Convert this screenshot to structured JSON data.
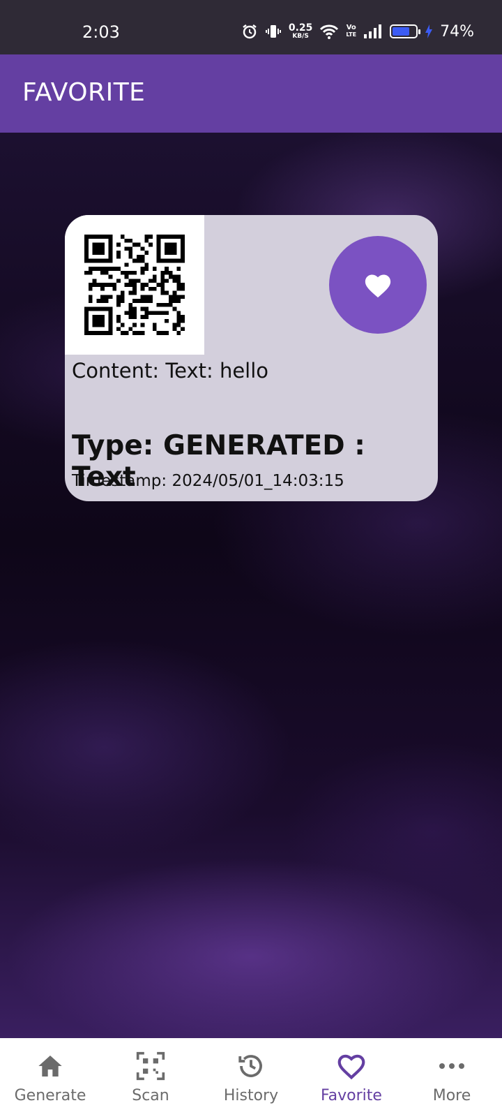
{
  "status_bar": {
    "time": "2:03",
    "net_speed_value": "0.25",
    "net_speed_unit": "KB/S",
    "volte_top": "Vo",
    "volte_bottom": "LTE",
    "battery_percent": "74%",
    "battery_level": 0.74,
    "icons": [
      "alarm-icon",
      "vibrate-icon",
      "wifi-icon",
      "signal-icon",
      "battery-icon",
      "charging-icon"
    ]
  },
  "app_bar": {
    "title": "FAVORITE"
  },
  "favorite_card": {
    "content": "Content: Text: hello",
    "type": "Type: GENERATED : Text",
    "timestamp": "Timestamp: 2024/05/01_14:03:15",
    "favorite_icon": "heart-icon"
  },
  "bottom_nav": {
    "items": [
      {
        "label": "Generate",
        "icon": "home-icon"
      },
      {
        "label": "Scan",
        "icon": "qr-scan-icon"
      },
      {
        "label": "History",
        "icon": "history-icon"
      },
      {
        "label": "Favorite",
        "icon": "heart-outline-icon"
      },
      {
        "label": "More",
        "icon": "more-icon"
      }
    ],
    "active": "Favorite"
  },
  "colors": {
    "status_bar": "#2f2a36",
    "app_bar": "#643fa2",
    "card": "#d3cfdc",
    "fav_button": "#7b52c2",
    "active_nav": "#643fa2",
    "inactive_nav": "#6b6b6b"
  }
}
